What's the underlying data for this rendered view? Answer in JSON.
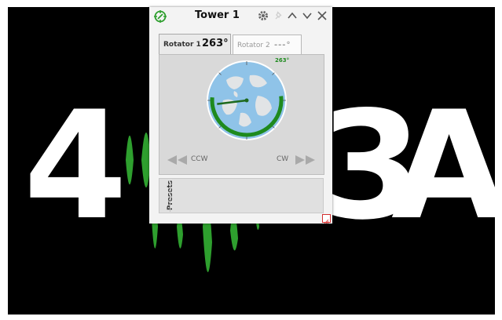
{
  "background": {
    "call_sign_left": "4",
    "call_sign_mid": "3",
    "call_sign_right": "A",
    "text_color": "#ffffff",
    "bg_color": "#000000",
    "waveform_color": "#2e9f2e"
  },
  "window": {
    "title": "Tower 1",
    "icons": [
      "rotator-logo-icon",
      "gear-icon",
      "pin-icon",
      "chevron-up-icon",
      "chevron-down-icon",
      "close-icon"
    ]
  },
  "tabs": [
    {
      "label": "Rotator 1",
      "heading": "263°"
    },
    {
      "label": "Rotator 2",
      "heading": "---°"
    }
  ],
  "compass": {
    "heading_label": "263°",
    "heading_deg": 263,
    "accent": "#1e8a1e"
  },
  "controls": {
    "ccw_label": "CCW",
    "cw_label": "CW"
  },
  "presets": {
    "label": "Presets"
  }
}
